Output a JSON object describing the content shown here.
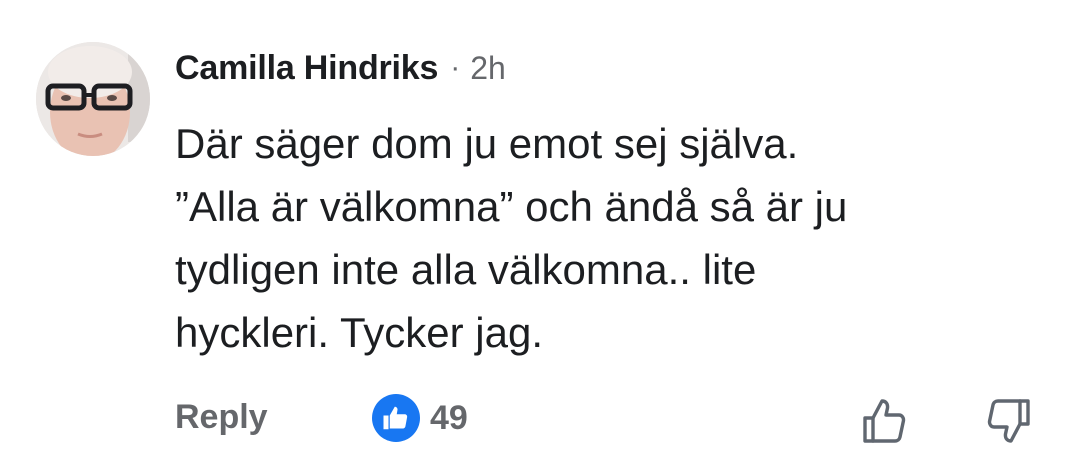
{
  "comment": {
    "author": "Camilla Hindriks",
    "separator": "·",
    "time": "2h",
    "body_lines": [
      "Där säger dom ju emot sej själva.",
      "”Alla är välkomna” och ändå så är ju",
      "tydligen inte alla välkomna.. lite",
      "hyckleri. Tycker jag."
    ],
    "avatar_icon": "profile-photo",
    "actions": {
      "reply_label": "Reply",
      "reaction_icon": "like-reaction-icon",
      "reaction_count": "49",
      "upvote_icon": "thumbs-up-outline-icon",
      "downvote_icon": "thumbs-down-outline-icon"
    },
    "colors": {
      "text": "#1c1e21",
      "muted": "#65676b",
      "like_blue": "#1877f2"
    }
  }
}
